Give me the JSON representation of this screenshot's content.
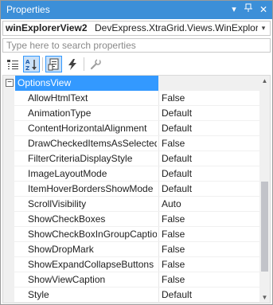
{
  "window": {
    "title": "Properties",
    "controls": {
      "dropdown": "▾",
      "pin": "⊓",
      "close": "✕"
    }
  },
  "object_selector": {
    "name": "winExplorerView2",
    "type": "DevExpress.XtraGrid.Views.WinExplorer.\\",
    "arrow": "▾"
  },
  "search": {
    "placeholder": "Type here to search properties",
    "value": ""
  },
  "toolbar": {
    "items": [
      {
        "icon": "categorized-icon",
        "active": false
      },
      {
        "icon": "alphabetical-icon",
        "active": true
      },
      {
        "icon": "properties-icon",
        "active": true
      },
      {
        "icon": "events-icon",
        "active": false
      },
      {
        "icon": "property-pages-icon",
        "active": false
      }
    ]
  },
  "grid": {
    "category": {
      "label": "OptionsView",
      "toggle": "−",
      "expanded": true
    },
    "rows": [
      {
        "name": "AllowHtmlText",
        "value": "False"
      },
      {
        "name": "AnimationType",
        "value": "Default"
      },
      {
        "name": "ContentHorizontalAlignment",
        "value": "Default"
      },
      {
        "name": "DrawCheckedItemsAsSelected",
        "value": "False"
      },
      {
        "name": "FilterCriteriaDisplayStyle",
        "value": "Default"
      },
      {
        "name": "ImageLayoutMode",
        "value": "Default"
      },
      {
        "name": "ItemHoverBordersShowMode",
        "value": "Default"
      },
      {
        "name": "ScrollVisibility",
        "value": "Auto"
      },
      {
        "name": "ShowCheckBoxes",
        "value": "False"
      },
      {
        "name": "ShowCheckBoxInGroupCaptio",
        "value": "False"
      },
      {
        "name": "ShowDropMark",
        "value": "False"
      },
      {
        "name": "ShowExpandCollapseButtons",
        "value": "False"
      },
      {
        "name": "ShowViewCaption",
        "value": "False"
      },
      {
        "name": "Style",
        "value": "Default"
      }
    ]
  },
  "scrollbar": {
    "up": "▲",
    "down": "▼",
    "position": 0.82
  },
  "colors": {
    "titlebar": "#3c8fd8",
    "selection": "#3399ff",
    "toolbar_active": "#c9e0f7"
  }
}
